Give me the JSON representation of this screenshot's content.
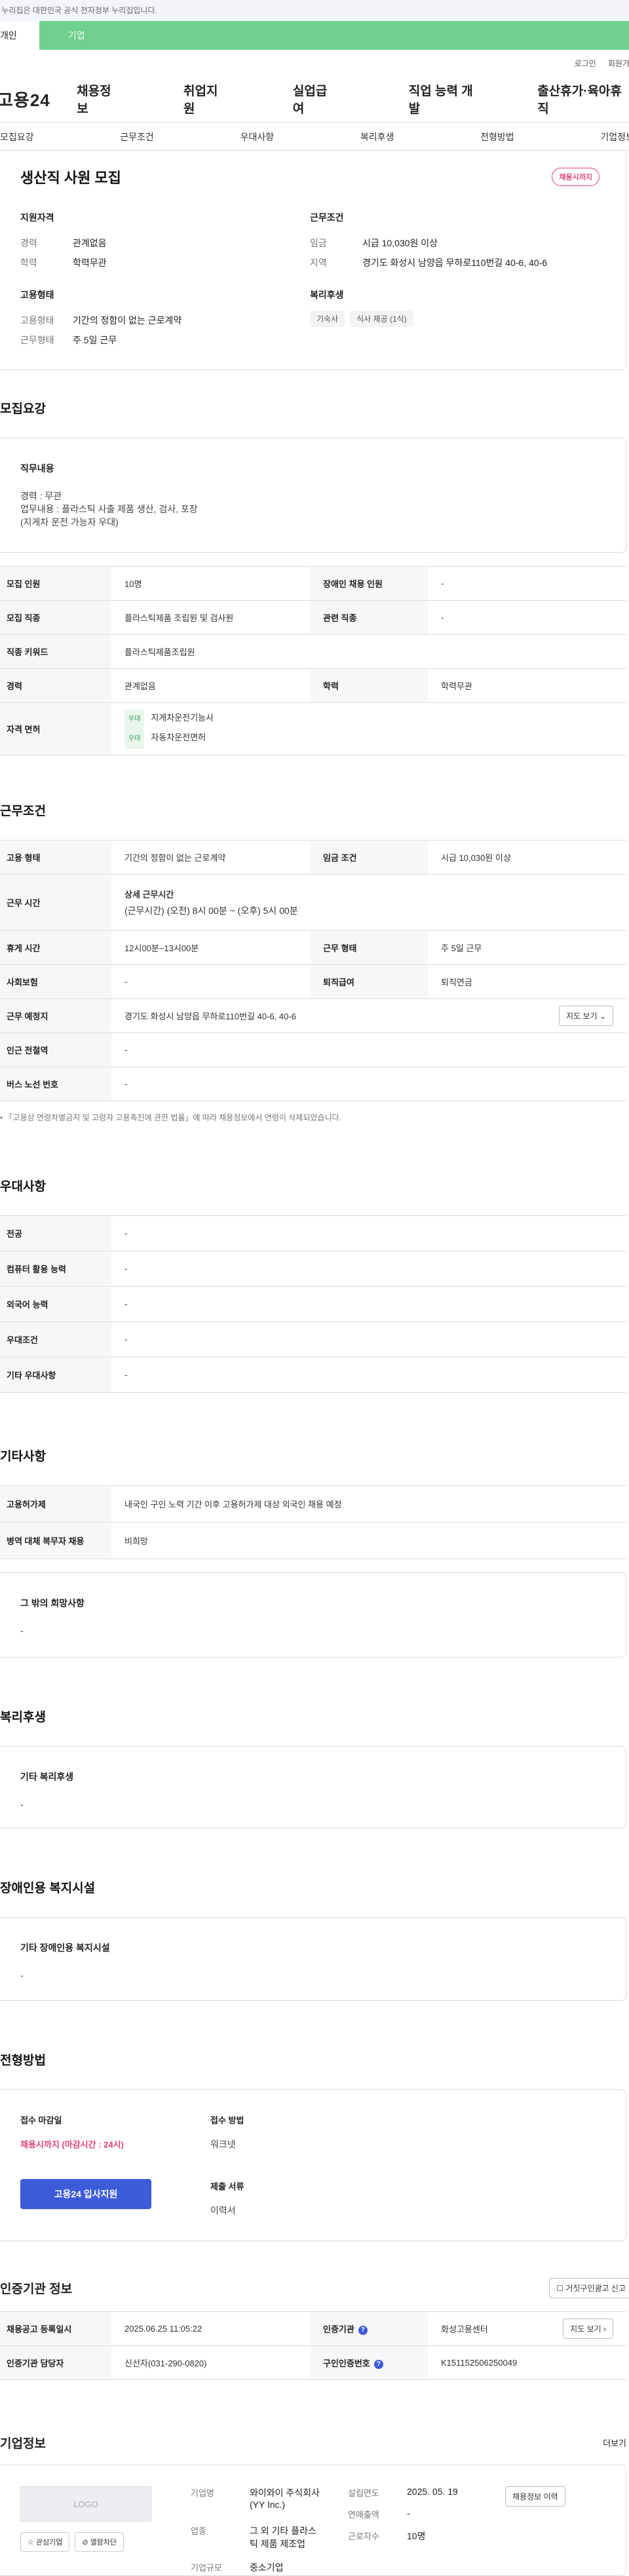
{
  "gov_notice": "이 누리집은 대한민국 공식 전자정부 누리집입니다.",
  "top_tabs": [
    "개인",
    "기업"
  ],
  "util": [
    "로그인",
    "회원가입"
  ],
  "logo": "고용24",
  "gnb": [
    "채용정보",
    "취업지원",
    "실업급여",
    "직업 능력 개발",
    "출산휴가·육아휴직"
  ],
  "anchors": [
    "모집요강",
    "근무조건",
    "우대사항",
    "복리후생",
    "전형방법",
    "기업정보"
  ],
  "summary": {
    "title": "생산직 사원 모집",
    "badge": "채용시까지",
    "qual_title": "지원자격",
    "career_k": "경력",
    "career_v": "관계없음",
    "edu_k": "학력",
    "edu_v": "학력무관",
    "emp_title": "고용형태",
    "emp_k": "고용형태",
    "emp_v": "기간의 정함이 없는 근로계약",
    "work_k": "근무형태",
    "work_v": "주 5일 근무",
    "cond_title": "근무조건",
    "wage_k": "임금",
    "wage_v": "시급 10,030원 이상",
    "region_k": "지역",
    "region_v": "경기도 화성시 남양읍 무하로110번길 40-6, 40-6",
    "welfare_title": "복리후생",
    "chips": [
      "기숙사",
      "식사 제공 (1식)"
    ]
  },
  "recruit": {
    "heading": "모집요강",
    "duty_title": "직무내용",
    "duty_text": [
      "경력 : 무관",
      "업무내용 : 플라스틱 사출 제품 생산, 검사, 포장",
      "(지게차 운전 가능자 우대)"
    ],
    "r1": [
      "모집 인원",
      "10명",
      "장애인 채용 인원",
      "-"
    ],
    "r2": [
      "모집 직종",
      "플라스틱제품 조립원 및 검사원",
      "관련 직종",
      "-"
    ],
    "r3": [
      "직종 키워드",
      "플라스틱제품조립원"
    ],
    "r4": [
      "경력",
      "관계없음",
      "학력",
      "학력무관"
    ],
    "license_k": "자격 면허",
    "licenses": [
      {
        "tag": "우대",
        "name": "지게차운전기능사"
      },
      {
        "tag": "우대",
        "name": "자동차운전면허"
      }
    ]
  },
  "work": {
    "heading": "근무조건",
    "r1": [
      "고용 형태",
      "기간의 정함이 없는 근로계약",
      "임금 조건",
      "시급 10,030원 이상"
    ],
    "hours_k": "근무 시간",
    "hours_t": "상세 근무시간",
    "hours_v": "(근무시간) (오전) 8시 00분 ~ (오후) 5시 00분",
    "r3": [
      "휴게 시간",
      "12시00분~13시00분",
      "근무 형태",
      "주 5일 근무"
    ],
    "r4": [
      "사회보험",
      "-",
      "퇴직급여",
      "퇴직연금"
    ],
    "place_k": "근무 예정지",
    "place_v": "경기도 화성시 남양읍 무하로110번길 40-6, 40-6",
    "map_btn": "지도 보기",
    "r6": [
      "인근 전철역",
      "-"
    ],
    "r7": [
      "버스 노선 번호",
      "-"
    ],
    "note": "「고용상 연령차별금지 및 고령자 고용촉진에 관한 법률」에 따라 채용정보에서 연령이 삭제되었습니다."
  },
  "pref": {
    "heading": "우대사항",
    "rows": [
      [
        "전공",
        "-"
      ],
      [
        "컴퓨터 활용 능력",
        "-"
      ],
      [
        "외국어 능력",
        "-"
      ],
      [
        "우대조건",
        "-"
      ],
      [
        "기타 우대사항",
        "-"
      ]
    ]
  },
  "etc": {
    "heading": "기타사항",
    "rows": [
      [
        "고용허가제",
        "내국인 구인 노력 기간 이후 고용허가제 대상 외국인 채용 예정"
      ],
      [
        "병역 대체 복무자 채용",
        "비희망"
      ]
    ],
    "hope_title": "그 밖의 희망사항",
    "hope_v": "-"
  },
  "welfare": {
    "heading": "복리후생",
    "title": "기타 복리후생",
    "v": "-"
  },
  "disabled": {
    "heading": "장애인용 복지시설",
    "title": "기타 장애인용 복지시설",
    "v": "-"
  },
  "select": {
    "heading": "전형방법",
    "deadline_t": "접수 마감일",
    "deadline_v": "채용시까지 (마감시간 : 24시)",
    "apply_btn": "고용24 입사지원",
    "method_t": "접수 방법",
    "method_v": "워크넷",
    "docs_t": "제출 서류",
    "docs_v": "이력서"
  },
  "cert": {
    "heading": "인증기관 정보",
    "report_btn": "거짓구인광고 신고",
    "r1": [
      "채용공고 등록일시",
      "2025.06.25 11:05:22",
      "인증기관",
      "화성고용센터"
    ],
    "r2": [
      "인증기관 담당자",
      "신선자(031-290-0820)",
      "구인인증번호",
      "K151152506250049"
    ],
    "map_btn": "지도 보기"
  },
  "company": {
    "heading": "기업정보",
    "more": "더보기",
    "logo": "LOGO",
    "interest_btn": "관심기업",
    "block_btn": "열람차단",
    "name_k": "기업명",
    "name_v": "와이와이 주식회사(YY Inc.)",
    "ind_k": "업종",
    "ind_v": "그 외 기타 플라스틱 제품 제조업",
    "size_k": "기업규모",
    "size_v": "중소기업",
    "est_k": "설립연도",
    "est_v": "2025. 05. 19",
    "sales_k": "연매출액",
    "sales_v": "-",
    "emp_k": "근로자수",
    "emp_v": "10명",
    "history_btn": "채용정보 이력"
  }
}
